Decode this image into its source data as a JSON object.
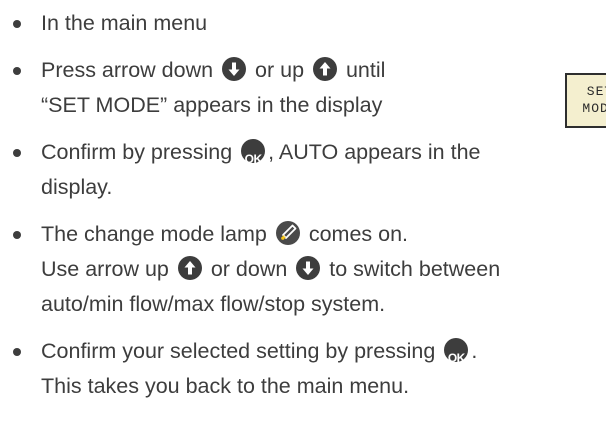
{
  "instructions": [
    {
      "lines": [
        [
          "In the main menu"
        ]
      ]
    },
    {
      "lines": [
        [
          "Press arrow down ",
          {
            "icon": "arrow-down-icon"
          },
          " or up ",
          {
            "icon": "arrow-up-icon"
          },
          " until"
        ],
        [
          "“SET MODE” appears in the display"
        ]
      ]
    },
    {
      "lines": [
        [
          "Confirm by pressing ",
          {
            "icon": "ok-icon"
          },
          ", AUTO appears in the"
        ],
        [
          "display."
        ]
      ]
    },
    {
      "lines": [
        [
          "The change mode lamp ",
          {
            "icon": "lamp-icon"
          },
          " comes on."
        ],
        [
          "Use arrow up ",
          {
            "icon": "arrow-up-icon"
          },
          " or down ",
          {
            "icon": "arrow-down-icon"
          },
          " to switch between"
        ],
        [
          "auto/min flow/max flow/stop system."
        ]
      ]
    },
    {
      "lines": [
        [
          "Confirm your selected setting by pressing ",
          {
            "icon": "ok-icon"
          },
          "."
        ],
        [
          "This takes you back to the main menu."
        ]
      ]
    }
  ],
  "icons": {
    "ok_label": "OK"
  },
  "display": {
    "line1": "SET",
    "line2": "MODE"
  },
  "colors": {
    "text": "#3d3d3d",
    "icon_bg": "#3d3d3d",
    "lamp": "#f5c518",
    "display_bg": "#f4efcf"
  }
}
